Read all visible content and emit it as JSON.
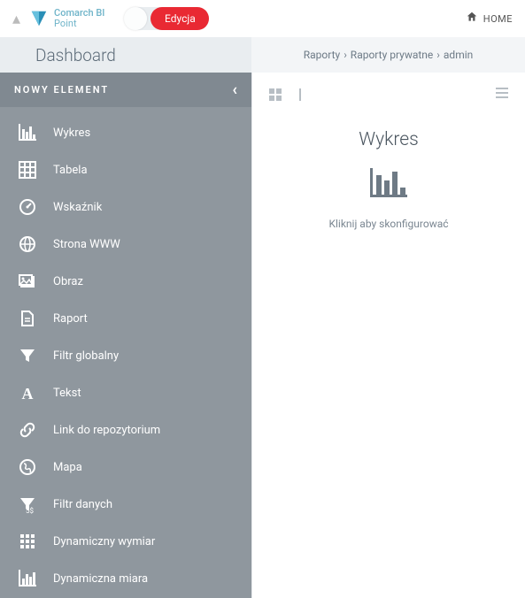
{
  "topbar": {
    "brand_line1": "Comarch BI",
    "brand_line2": "Point",
    "toggle_label": "Edycja",
    "home_label": "HOME"
  },
  "subhead": {
    "title": "Dashboard",
    "breadcrumb": [
      "Raporty",
      "Raporty prywatne",
      "admin"
    ]
  },
  "sidebar": {
    "title": "NOWY ELEMENT",
    "items": [
      {
        "label": "Wykres",
        "icon": "chart-bars-icon"
      },
      {
        "label": "Tabela",
        "icon": "table-icon"
      },
      {
        "label": "Wskaźnik",
        "icon": "gauge-icon"
      },
      {
        "label": "Strona WWW",
        "icon": "globe-icon"
      },
      {
        "label": "Obraz",
        "icon": "images-icon"
      },
      {
        "label": "Raport",
        "icon": "report-icon"
      },
      {
        "label": "Filtr globalny",
        "icon": "funnel-icon"
      },
      {
        "label": "Tekst",
        "icon": "text-a-icon"
      },
      {
        "label": "Link do repozytorium",
        "icon": "link-icon"
      },
      {
        "label": "Mapa",
        "icon": "globe2-icon"
      },
      {
        "label": "Filtr danych",
        "icon": "funnel-data-icon",
        "sub": "5$"
      },
      {
        "label": "Dynamiczny wymiar",
        "icon": "grid-dots-icon"
      },
      {
        "label": "Dynamiczna miara",
        "icon": "chart-bars2-icon"
      }
    ]
  },
  "content": {
    "widget_title": "Wykres",
    "widget_hint": "Kliknij aby skonfigurować"
  }
}
